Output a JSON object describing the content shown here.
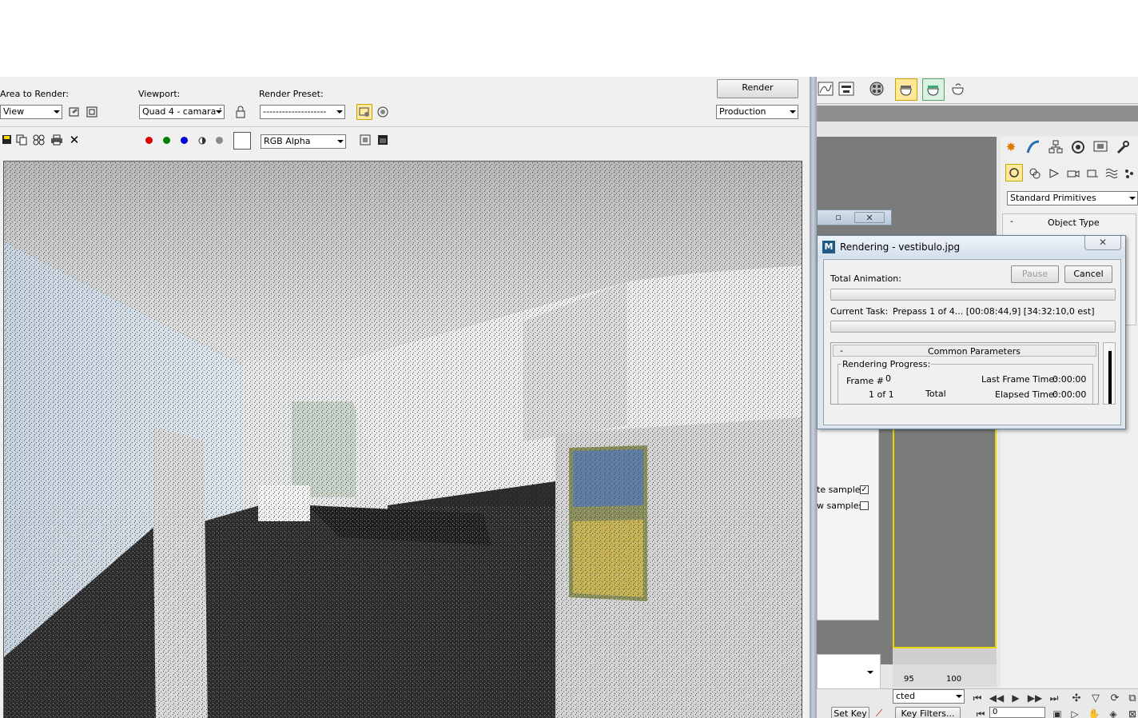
{
  "render_frame": {
    "area_to_render_label": "Area to Render:",
    "area_to_render_value": "View",
    "viewport_label": "Viewport:",
    "viewport_value": "Quad 4 - camara ’",
    "render_preset_label": "Render Preset:",
    "render_preset_value": "--------------------",
    "render_button": "Render",
    "production_value": "Production",
    "channel_value": "RGB Alpha",
    "channel_colors": {
      "red": "#e00000",
      "green": "#008000",
      "blue": "#0000dd",
      "mono": "#333333",
      "alpha": "#8a8a8a"
    }
  },
  "max_ui": {
    "geometry_dropdown": "Standard Primitives",
    "object_type_label": "Object Type",
    "collapse_minus": "-",
    "samples_1": "te samples",
    "samples_2": "w samples",
    "timeline_95": "95",
    "timeline_100": "100",
    "selected_partial": "cted",
    "set_key": "Set Key",
    "key_filters": "Key Filters...",
    "frame_field": "0"
  },
  "rendering_dialog": {
    "title": "Rendering - vestibulo.jpg",
    "close_glyph": "✕",
    "total_animation_label": "Total Animation:",
    "pause_button": "Pause",
    "cancel_button": "Cancel",
    "current_task_label": "Current Task:",
    "current_task_value": "Prepass 1 of 4... [00:08:44,9] [34:32:10,0 est]",
    "common_parameters_header": "Common Parameters",
    "collapse_minus": "-",
    "rendering_progress_label": "Rendering Progress:",
    "frame_label": "Frame #",
    "frame_value": "0",
    "one_of_one": "1 of 1",
    "total_label": "Total",
    "last_frame_time_label": "Last Frame Time:",
    "last_frame_time_value": "0:00:00",
    "elapsed_time_label": "Elapsed Time:",
    "elapsed_time_value": "0:00:00"
  }
}
